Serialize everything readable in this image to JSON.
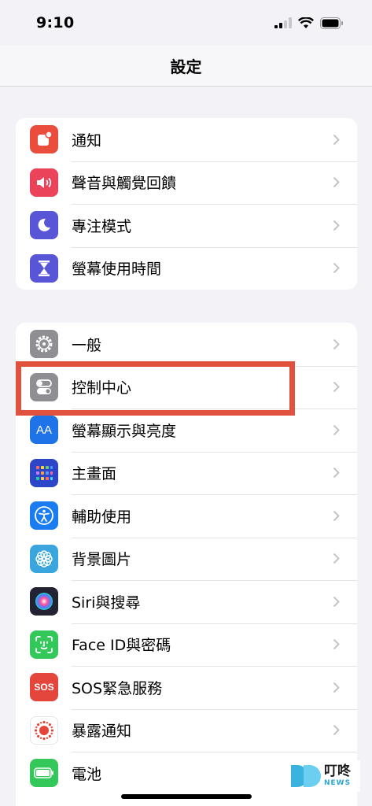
{
  "status_bar": {
    "time": "9:10"
  },
  "nav": {
    "title": "設定"
  },
  "group1": [
    {
      "label": "通知",
      "icon": "notification-icon",
      "color": "#eb4d3d"
    },
    {
      "label": "聲音與觸覺回饋",
      "icon": "speaker-icon",
      "color": "#eb445a"
    },
    {
      "label": "專注模式",
      "icon": "moon-icon",
      "color": "#5856d6"
    },
    {
      "label": "螢幕使用時間",
      "icon": "hourglass-icon",
      "color": "#5856d6"
    }
  ],
  "group2": [
    {
      "label": "一般",
      "icon": "gear-icon",
      "color": "#8e8e93"
    },
    {
      "label": "控制中心",
      "icon": "toggles-icon",
      "color": "#8e8e93"
    },
    {
      "label": "螢幕顯示與亮度",
      "icon": "text-size-icon",
      "color": "#1e73e8",
      "glyph": "AA"
    },
    {
      "label": "主畫面",
      "icon": "home-grid-icon",
      "color": "#2d46c8"
    },
    {
      "label": "輔助使用",
      "icon": "accessibility-icon",
      "color": "#1a7cf0"
    },
    {
      "label": "背景圖片",
      "icon": "wallpaper-flower-icon",
      "color": "#3aa6dd"
    },
    {
      "label": "Siri與搜尋",
      "icon": "siri-icon",
      "color": "#222233"
    },
    {
      "label": "Face ID與密碼",
      "icon": "face-id-icon",
      "color": "#34c759"
    },
    {
      "label": "SOS緊急服務",
      "icon": "sos-icon",
      "color": "#e5463b",
      "glyph": "SOS"
    },
    {
      "label": "暴露通知",
      "icon": "exposure-icon",
      "color": "#ffffff"
    },
    {
      "label": "電池",
      "icon": "battery-icon",
      "color": "#34c759"
    }
  ],
  "watermark": {
    "cn": "叮咚",
    "en": "NEWS"
  }
}
